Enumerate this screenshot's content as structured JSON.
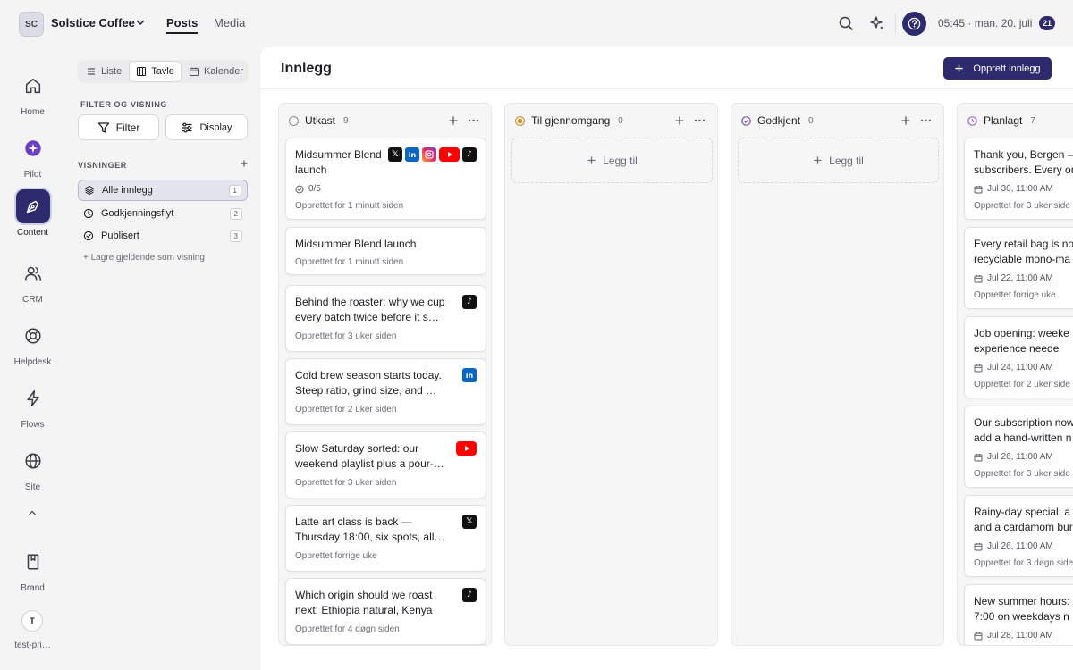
{
  "workspace": {
    "initials": "SC",
    "name": "Solstice Coffee"
  },
  "top_nav": {
    "posts": "Posts",
    "media": "Media"
  },
  "topbar": {
    "time": "05:45 · man. 20. juli",
    "notification_count": "21"
  },
  "rail": {
    "items": [
      {
        "label": "Home",
        "icon": "home-icon"
      },
      {
        "label": "Pilot",
        "icon": "pilot-icon"
      },
      {
        "label": "Content",
        "icon": "pen-nib-icon",
        "active": true
      },
      {
        "label": "CRM",
        "icon": "users-icon"
      },
      {
        "label": "Helpdesk",
        "icon": "lifebuoy-icon"
      },
      {
        "label": "Flows",
        "icon": "bolt-icon"
      },
      {
        "label": "Site",
        "icon": "globe-icon"
      },
      {
        "label": "Brand",
        "icon": "book-icon"
      }
    ],
    "user_initial": "T",
    "user_label": "test-pri…"
  },
  "view_switch": {
    "list": "Liste",
    "board": "Tavle",
    "calendar": "Kalender",
    "active": "Tavle"
  },
  "filter_section": {
    "label": "FILTER OG VISNING",
    "filter": "Filter",
    "display": "Display"
  },
  "views_section": {
    "label": "VISNINGER",
    "items": [
      {
        "label": "Alle innlegg",
        "count": "1",
        "icon": "layers-icon",
        "active": true
      },
      {
        "label": "Godkjenningsflyt",
        "count": "2",
        "icon": "clock-icon"
      },
      {
        "label": "Publisert",
        "count": "3",
        "icon": "check-circle-icon"
      }
    ],
    "save_view": "+ Lagre gjeldende som visning"
  },
  "main": {
    "title": "Innlegg",
    "create_button": "Opprett innlegg"
  },
  "columns": [
    {
      "title": "Utkast",
      "count": "9",
      "status_color": "#8a8a94",
      "cards": [
        {
          "title": "Midsummer Blend launch",
          "progress": "0/5",
          "meta": "Opprettet for 1 minutt siden",
          "platforms": [
            "x",
            "linkedin",
            "instagram",
            "youtube",
            "tiktok"
          ]
        },
        {
          "title": "Midsummer Blend launch",
          "meta": "Opprettet for 1 minutt siden",
          "platforms": []
        },
        {
          "title": "Behind the roaster: why we cup every batch twice before it s…",
          "meta": "Opprettet for 3 uker siden",
          "platforms": [
            "tiktok"
          ]
        },
        {
          "title": "Cold brew season starts today. Steep ratio, grind size, and …",
          "meta": "Opprettet for 2 uker siden",
          "platforms": [
            "linkedin"
          ]
        },
        {
          "title": "Slow Saturday sorted: our weekend playlist plus a pour-…",
          "meta": "Opprettet for 3 uker siden",
          "platforms": [
            "youtube"
          ]
        },
        {
          "title": "Latte art class is back — Thursday 18:00, six spots, all…",
          "meta": "Opprettet forrige uke",
          "platforms": [
            "x"
          ]
        },
        {
          "title": "Which origin should we roast next: Ethiopia natural, Kenya w…",
          "meta": "Opprettet for 4 døgn siden",
          "platforms": [
            "tiktok"
          ]
        }
      ]
    },
    {
      "title": "Til gjennomgang",
      "count": "0",
      "status_color": "#d98a1c",
      "add_label": "Legg til"
    },
    {
      "title": "Godkjent",
      "count": "0",
      "status_color": "#7a52b8",
      "add_label": "Legg til"
    },
    {
      "title": "Planlagt",
      "count": "7",
      "status_color": "#9c6fd0",
      "cards": [
        {
          "title": "Thank you, Bergen — subscribers. Every or",
          "schedule": "Jul 30, 11:00 AM",
          "meta": "Opprettet for 3 uker side"
        },
        {
          "title": "Every retail bag is no recyclable mono-ma",
          "schedule": "Jul 22, 11:00 AM",
          "meta": "Opprettet forrige uke"
        },
        {
          "title": "Job opening: weeke No experience neede",
          "schedule": "Jul 24, 11:00 AM",
          "meta": "Opprettet for 2 uker side"
        },
        {
          "title": "Our subscription now add a hand-written n",
          "schedule": "Jul 26, 11:00 AM",
          "meta": "Opprettet for 3 uker side"
        },
        {
          "title": "Rainy-day special: a and a cardamom bur",
          "schedule": "Jul 26, 11:00 AM",
          "meta": "Opprettet for 3 døgn side"
        },
        {
          "title": "New summer hours: 7:00 on weekdays n",
          "schedule": "Jul 28, 11:00 AM",
          "meta": ""
        }
      ]
    }
  ]
}
